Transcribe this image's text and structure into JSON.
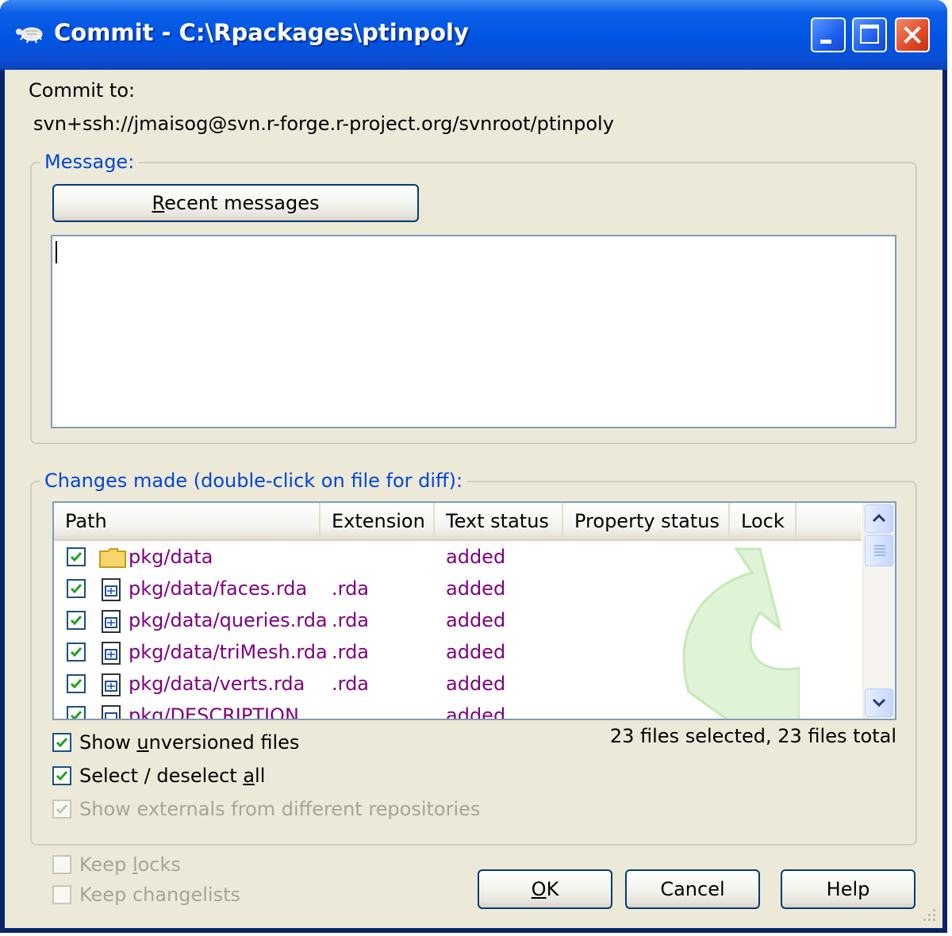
{
  "window": {
    "title": "Commit - C:\\Rpackages\\ptinpoly",
    "icons": {
      "app": "tortoise-icon",
      "min": "minimize-icon",
      "max": "maximize-icon",
      "close": "close-icon"
    }
  },
  "commit_to": {
    "label": "Commit to:",
    "url": "svn+ssh://jmaisog@svn.r-forge.r-project.org/svnroot/ptinpoly"
  },
  "message_group": {
    "title": "Message:",
    "recent_button": "Recent messages",
    "text": ""
  },
  "changes_group": {
    "title": "Changes made (double-click on file for diff):",
    "columns": [
      "Path",
      "Extension",
      "Text status",
      "Property status",
      "Lock"
    ],
    "rows": [
      {
        "checked": true,
        "icon": "folder-icon",
        "path": "pkg/data",
        "extension": "",
        "text_status": "added"
      },
      {
        "checked": true,
        "icon": "rdata-file-icon",
        "path": "pkg/data/faces.rda",
        "extension": ".rda",
        "text_status": "added"
      },
      {
        "checked": true,
        "icon": "rdata-file-icon",
        "path": "pkg/data/queries.rda",
        "extension": ".rda",
        "text_status": "added"
      },
      {
        "checked": true,
        "icon": "rdata-file-icon",
        "path": "pkg/data/triMesh.rda",
        "extension": ".rda",
        "text_status": "added"
      },
      {
        "checked": true,
        "icon": "rdata-file-icon",
        "path": "pkg/data/verts.rda",
        "extension": ".rda",
        "text_status": "added"
      },
      {
        "checked": true,
        "icon": "file-icon",
        "path": "pkg/DESCRIPTION",
        "extension": "",
        "text_status": "added"
      }
    ],
    "summary": "23 files selected, 23 files total",
    "status_color": "#800080"
  },
  "options": {
    "show_unversioned": {
      "prefix": "Show ",
      "mnemonic": "u",
      "suffix": "nversioned files",
      "checked": true
    },
    "select_all": {
      "prefix": "Select / deselect ",
      "mnemonic": "a",
      "suffix": "ll",
      "checked": true
    },
    "show_externals": {
      "label": "Show externals from different repositories",
      "checked": true,
      "enabled": false
    },
    "keep_locks": {
      "prefix": "Keep ",
      "mnemonic": "l",
      "suffix": "ocks",
      "checked": false,
      "enabled": false
    },
    "keep_changelists": {
      "label": "Keep changelists",
      "checked": false,
      "enabled": false
    }
  },
  "buttons": {
    "ok": {
      "mnemonic": "O",
      "rest": "K"
    },
    "cancel": "Cancel",
    "help": "Help"
  },
  "colors": {
    "titlebar": "#0054e3",
    "group_title": "#0046d5",
    "dialog_bg": "#ece9d8"
  }
}
